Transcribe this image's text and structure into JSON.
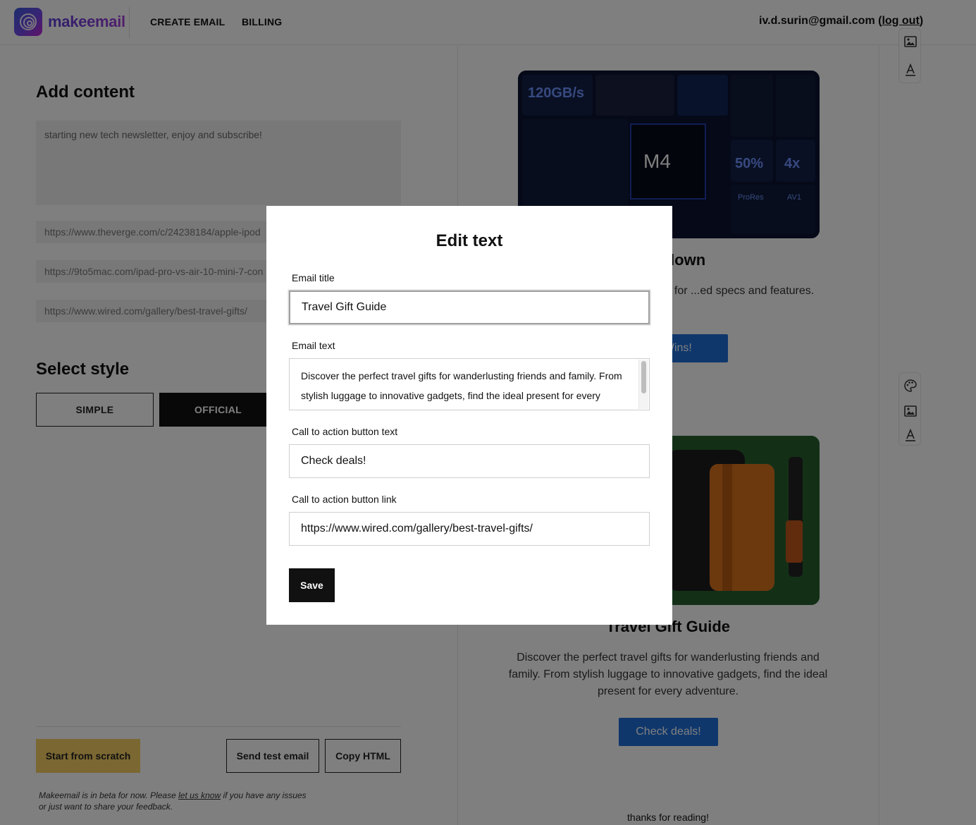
{
  "header": {
    "brand": "makeemail",
    "nav": {
      "create_email": "CREATE EMAIL",
      "billing": "BILLING"
    },
    "user_email": "iv.d.surin@gmail.com",
    "logout_label": "log out"
  },
  "left": {
    "add_content_heading": "Add content",
    "content_text": "starting new tech newsletter, enjoy and subscribe!",
    "urls": [
      "https://www.theverge.com/c/24238184/apple-ipod",
      "https://9to5mac.com/ipad-pro-vs-air-10-mini-7-con",
      "https://www.wired.com/gallery/best-travel-gifts/"
    ],
    "select_style_heading": "Select style",
    "styles": {
      "simple": "SIMPLE",
      "official": "OFFICIAL"
    },
    "buttons": {
      "start_scratch": "Start from scratch",
      "send_test": "Send test email",
      "copy_html": "Copy HTML"
    },
    "beta_note": {
      "before": "Makeemail is in beta for now. Please ",
      "link": "let us know",
      "after": " if you have any issues or just want to share your feedback."
    }
  },
  "preview": {
    "block1": {
      "title": "...owdown",
      "text": "...Mini. Discover the best iPad for ...ed specs and features.",
      "cta": "...h Wins!",
      "image_labels": {
        "bandwidth": "120GB/s",
        "chip": "M4",
        "pct": "50%",
        "mult": "4x",
        "codec1": "ProRes",
        "codec2": "AV1"
      }
    },
    "block2": {
      "title": "Travel Gift Guide",
      "text": "Discover the perfect travel gifts for wanderlusting friends and family. From stylish luggage to innovative gadgets, find the ideal present for every adventure.",
      "cta": "Check deals!"
    },
    "footer": "thanks for reading!"
  },
  "modal": {
    "title": "Edit text",
    "labels": {
      "email_title": "Email title",
      "email_text": "Email text",
      "cta_text": "Call to action button text",
      "cta_link": "Call to action button link"
    },
    "values": {
      "email_title": "Travel Gift Guide",
      "email_text": "Discover the perfect travel gifts for wanderlusting friends and family. From stylish luggage to innovative gadgets, find the ideal present for every",
      "cta_text": "Check deals!",
      "cta_link": "https://www.wired.com/gallery/best-travel-gifts/"
    },
    "save_label": "Save"
  },
  "colors": {
    "accent_yellow": "#f6cf63",
    "cta_blue": "#1e6fd9",
    "brand_purple": "#6a3fd8"
  },
  "icons": [
    "logo-icon",
    "palette-icon",
    "image-icon",
    "text-style-icon"
  ]
}
